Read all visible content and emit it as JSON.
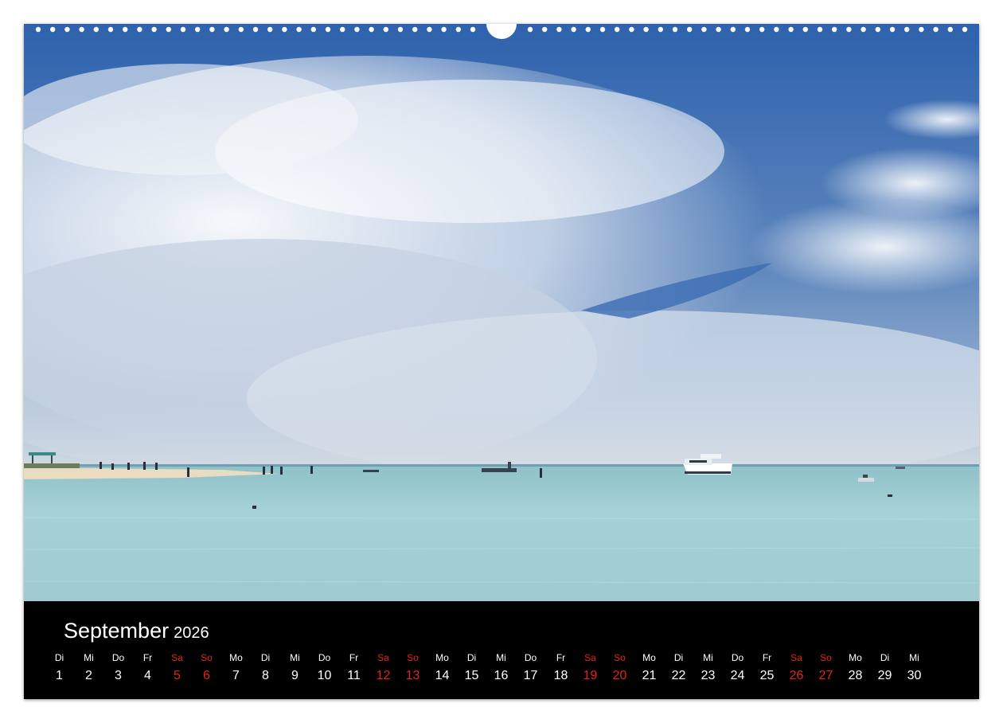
{
  "calendar": {
    "month": "September",
    "year": "2026",
    "weekend_color": "#e2231a",
    "days": [
      {
        "weekday": "Di",
        "day": "1",
        "weekend": false
      },
      {
        "weekday": "Mi",
        "day": "2",
        "weekend": false
      },
      {
        "weekday": "Do",
        "day": "3",
        "weekend": false
      },
      {
        "weekday": "Fr",
        "day": "4",
        "weekend": false
      },
      {
        "weekday": "Sa",
        "day": "5",
        "weekend": true
      },
      {
        "weekday": "So",
        "day": "6",
        "weekend": true
      },
      {
        "weekday": "Mo",
        "day": "7",
        "weekend": false
      },
      {
        "weekday": "Di",
        "day": "8",
        "weekend": false
      },
      {
        "weekday": "Mi",
        "day": "9",
        "weekend": false
      },
      {
        "weekday": "Do",
        "day": "10",
        "weekend": false
      },
      {
        "weekday": "Fr",
        "day": "11",
        "weekend": false
      },
      {
        "weekday": "Sa",
        "day": "12",
        "weekend": true
      },
      {
        "weekday": "So",
        "day": "13",
        "weekend": true
      },
      {
        "weekday": "Mo",
        "day": "14",
        "weekend": false
      },
      {
        "weekday": "Di",
        "day": "15",
        "weekend": false
      },
      {
        "weekday": "Mi",
        "day": "16",
        "weekend": false
      },
      {
        "weekday": "Do",
        "day": "17",
        "weekend": false
      },
      {
        "weekday": "Fr",
        "day": "18",
        "weekend": false
      },
      {
        "weekday": "Sa",
        "day": "19",
        "weekend": true
      },
      {
        "weekday": "So",
        "day": "20",
        "weekend": true
      },
      {
        "weekday": "Mo",
        "day": "21",
        "weekend": false
      },
      {
        "weekday": "Di",
        "day": "22",
        "weekend": false
      },
      {
        "weekday": "Mi",
        "day": "23",
        "weekend": false
      },
      {
        "weekday": "Do",
        "day": "24",
        "weekend": false
      },
      {
        "weekday": "Fr",
        "day": "25",
        "weekend": false
      },
      {
        "weekday": "Sa",
        "day": "26",
        "weekend": true
      },
      {
        "weekday": "So",
        "day": "27",
        "weekend": true
      },
      {
        "weekday": "Mo",
        "day": "28",
        "weekend": false
      },
      {
        "weekday": "Di",
        "day": "29",
        "weekend": false
      },
      {
        "weekday": "Mi",
        "day": "30",
        "weekend": false
      }
    ]
  },
  "photo": {
    "sky_color": "#2f64b0",
    "sea_color": "#9fcfd4",
    "sand_color": "#e9dcc0"
  }
}
